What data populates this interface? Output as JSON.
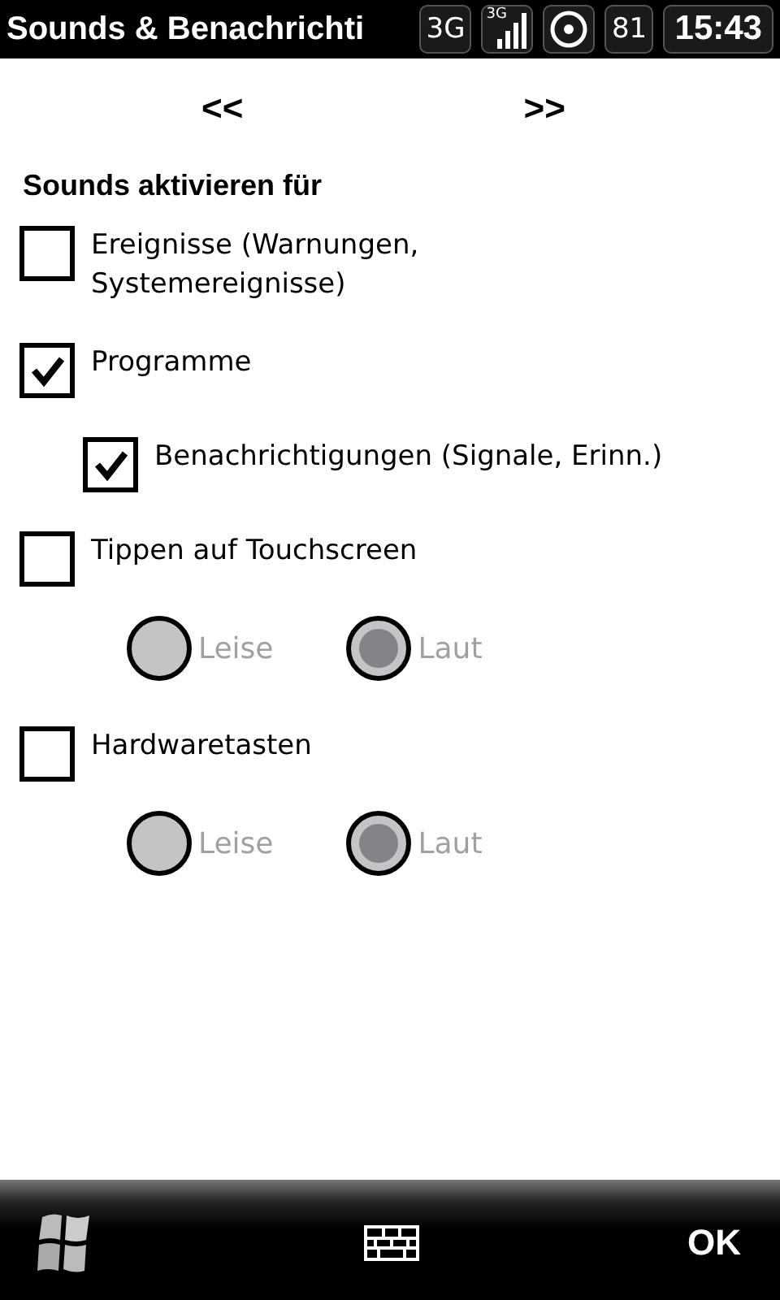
{
  "title_bar": {
    "title": "Sounds & Benachrichti",
    "network": "3G",
    "signal_label": "3G",
    "battery": "81",
    "time": "15:43"
  },
  "nav": {
    "prev": "<<",
    "next": ">>"
  },
  "heading": "Sounds aktivieren für",
  "options": [
    {
      "label": "Ereignisse (Warnungen, Systemereignisse)",
      "checked": false
    },
    {
      "label": "Programme",
      "checked": true,
      "children": [
        {
          "label": "Benachrichtigungen (Signale, Erinn.)",
          "checked": true
        }
      ]
    },
    {
      "label": "Tippen auf Touchscreen",
      "checked": false,
      "radios": [
        {
          "label": "Leise",
          "selected": false,
          "disabled": true
        },
        {
          "label": "Laut",
          "selected": true,
          "disabled": true
        }
      ]
    },
    {
      "label": "Hardwaretasten",
      "checked": false,
      "radios": [
        {
          "label": "Leise",
          "selected": false,
          "disabled": true
        },
        {
          "label": "Laut",
          "selected": true,
          "disabled": true
        }
      ]
    }
  ],
  "softkeys": {
    "right": "OK"
  }
}
